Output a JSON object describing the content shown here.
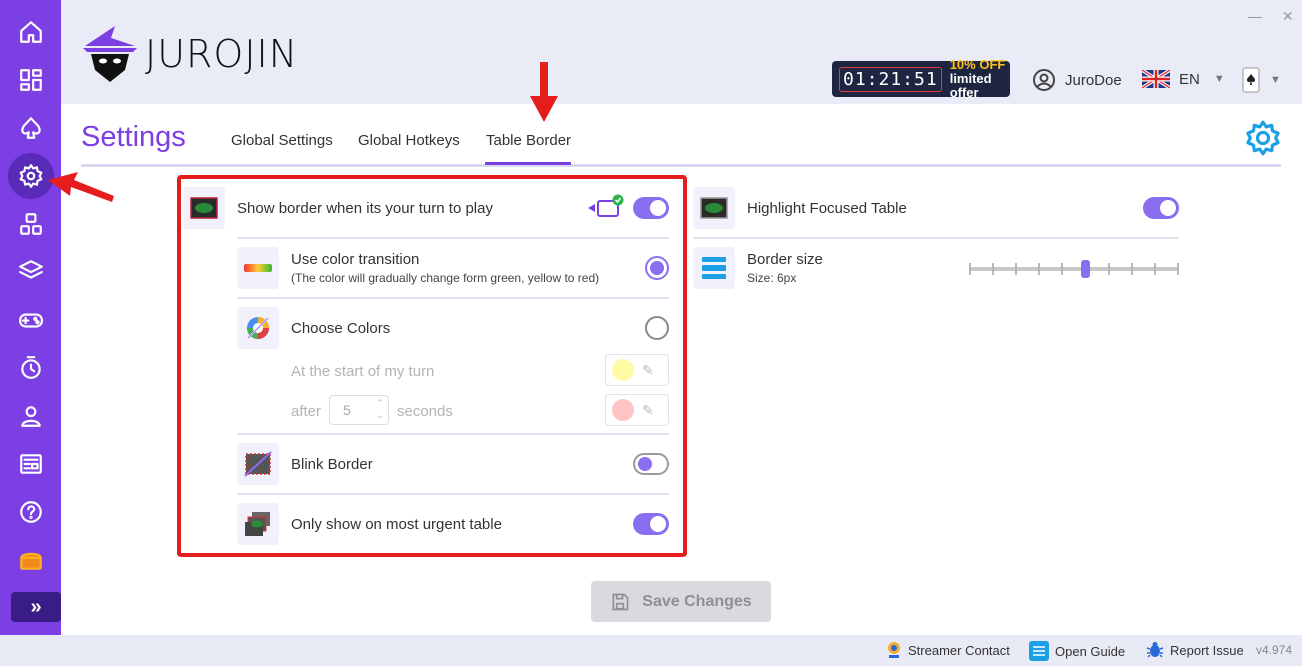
{
  "app": {
    "name": "JUROJIN",
    "minimize": "—",
    "close": "✕"
  },
  "offer": {
    "timer": "01:21:51",
    "discount": "10% OFF",
    "label": "limited offer"
  },
  "user": {
    "name": "JuroDoe"
  },
  "language": {
    "code": "EN"
  },
  "page": {
    "title": "Settings",
    "tabs": [
      {
        "label": "Global Settings"
      },
      {
        "label": "Global Hotkeys"
      },
      {
        "label": "Table Border",
        "active": true
      }
    ]
  },
  "left_settings": {
    "show_border": {
      "label": "Show border when its your turn to play",
      "enabled": true
    },
    "color_transition": {
      "label": "Use color transition",
      "desc": "(The color will gradually change form green, yellow to red)",
      "selected": true
    },
    "choose_colors": {
      "label": "Choose Colors",
      "selected": false
    },
    "start_turn": {
      "label": "At the start of my turn",
      "color": "#fffaa6"
    },
    "after": {
      "prefix": "after",
      "value": "5",
      "suffix": "seconds",
      "color": "#ffc4c4"
    },
    "blink_border": {
      "label": "Blink Border",
      "enabled": false
    },
    "urgent_only": {
      "label": "Only show on most urgent table",
      "enabled": true
    }
  },
  "right_settings": {
    "highlight_focused": {
      "label": "Highlight Focused Table",
      "enabled": true
    },
    "border_size": {
      "label": "Border size",
      "value_text": "Size: 6px",
      "value": 6,
      "min": 1,
      "max": 10
    }
  },
  "save_button": {
    "label": "Save Changes"
  },
  "footer": {
    "streamer": "Streamer Contact",
    "guide": "Open Guide",
    "report": "Report Issue",
    "version": "v4.974"
  },
  "colors": {
    "accent": "#7b3fe4",
    "toggle": "#8a6ef0",
    "highlight": "#e51d1d"
  }
}
